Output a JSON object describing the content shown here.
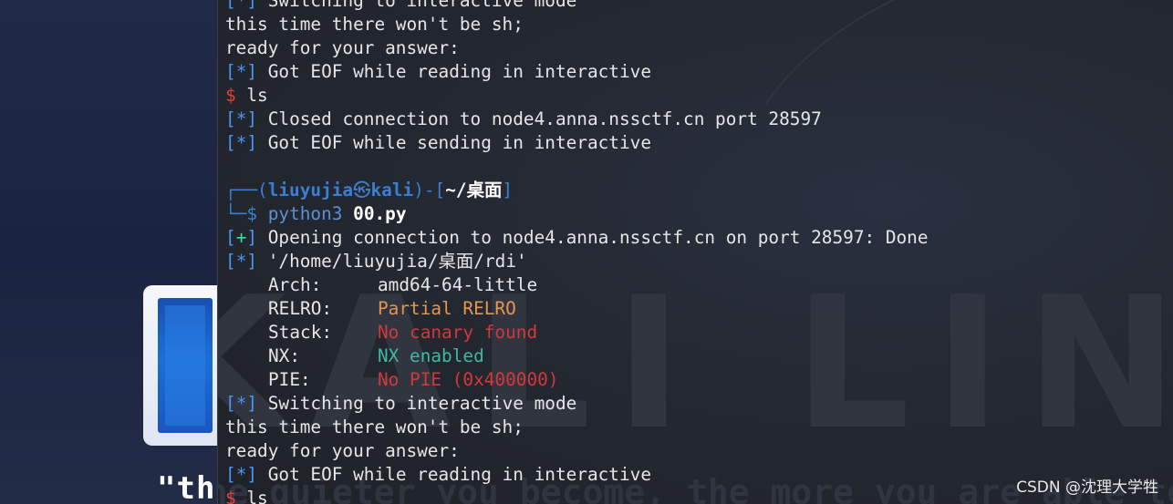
{
  "desktop": {
    "tagline": "\"th"
  },
  "terminal_background": {
    "watermark_logo": "KALI LINUX",
    "watermark_tagline": "\"the quieter you become, the more you are able to hear\""
  },
  "terminal": {
    "lines": [
      {
        "kind": "status",
        "mark": "*",
        "text": " Switching to interactive mode"
      },
      {
        "kind": "plain",
        "text": "this time there won't be sh;"
      },
      {
        "kind": "plain",
        "text": "ready for your answer:"
      },
      {
        "kind": "status",
        "mark": "*",
        "text": " Got EOF while reading in interactive"
      },
      {
        "kind": "input",
        "prompt": "$",
        "text": " ls"
      },
      {
        "kind": "status",
        "mark": "*",
        "text": " Closed connection to node4.anna.nssctf.cn port 28597"
      },
      {
        "kind": "status",
        "mark": "*",
        "text": " Got EOF while sending in interactive"
      },
      {
        "kind": "blank",
        "text": ""
      },
      {
        "kind": "prompt_header",
        "box_start": "┌──(",
        "user": "liuyujia",
        "at": "㉿",
        "host": "kali",
        "mid": ")-[",
        "path": "~/桌面",
        "box_end": "]"
      },
      {
        "kind": "prompt_cmd",
        "box": "└─",
        "prompt": "$",
        "cmd": "python3",
        "arg": "00.py"
      },
      {
        "kind": "status",
        "mark": "+",
        "text": " Opening connection to node4.anna.nssctf.cn on port 28597: Done"
      },
      {
        "kind": "status",
        "mark": "*",
        "text": " '/home/liuyujia/桌面/rdi'"
      },
      {
        "kind": "checksec",
        "label": "Arch:",
        "value": "amd64-64-little",
        "color": "plain"
      },
      {
        "kind": "checksec",
        "label": "RELRO:",
        "value": "Partial RELRO",
        "color": "orange"
      },
      {
        "kind": "checksec",
        "label": "Stack:",
        "value": "No canary found",
        "color": "red"
      },
      {
        "kind": "checksec",
        "label": "NX:",
        "value": "NX enabled",
        "color": "teal"
      },
      {
        "kind": "checksec",
        "label": "PIE:",
        "value": "No PIE (0x400000)",
        "color": "red"
      },
      {
        "kind": "status",
        "mark": "*",
        "text": " Switching to interactive mode"
      },
      {
        "kind": "plain",
        "text": "this time there won't be sh;"
      },
      {
        "kind": "plain",
        "text": "ready for your answer:"
      },
      {
        "kind": "status",
        "mark": "*",
        "text": " Got EOF while reading in interactive"
      },
      {
        "kind": "input",
        "prompt": "$",
        "text": " ls"
      }
    ]
  },
  "watermark": "CSDN @沈理大学牲",
  "colors": {
    "status_bracket": "#4b95f3",
    "plus_mark": "#2ee59a",
    "dollar": "#e0443a",
    "prompt_box": "#3c7fd1",
    "orange": "#e5964e",
    "red": "#d4383d",
    "teal": "#3fb8a4"
  }
}
